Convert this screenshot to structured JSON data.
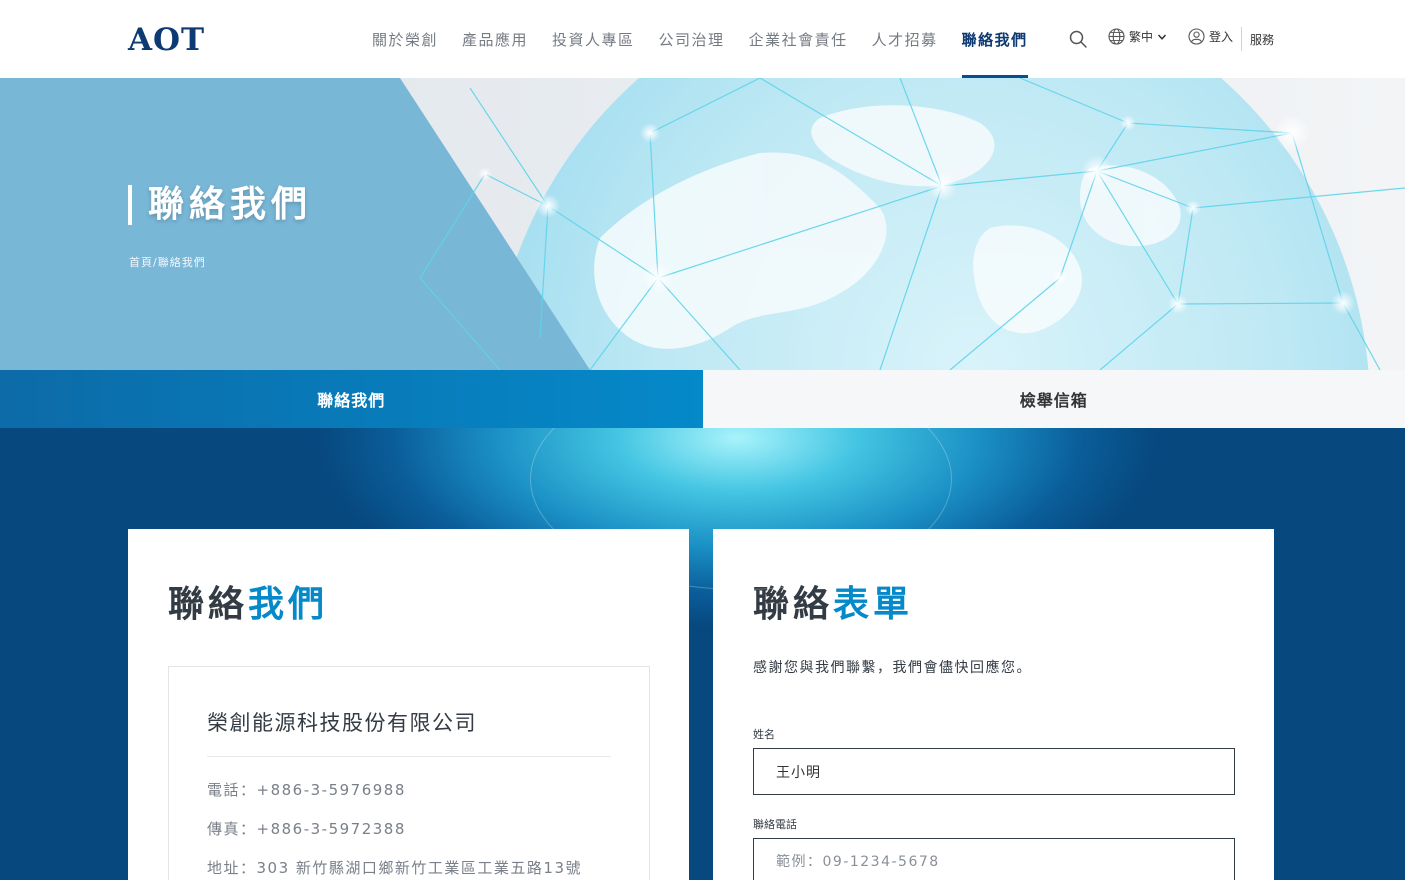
{
  "header": {
    "logo": "AOT",
    "nav": [
      "關於榮創",
      "產品應用",
      "投資人專區",
      "公司治理",
      "企業社會責任",
      "人才招募",
      "聯絡我們"
    ],
    "active_nav": "聯絡我們",
    "lang_label": "繁中",
    "login_label": "登入",
    "service_label": "服務"
  },
  "hero": {
    "title": "聯絡我們",
    "breadcrumb": "首頁/聯絡我們"
  },
  "tabs": [
    {
      "label": "聯絡我們",
      "active": true
    },
    {
      "label": "檢舉信箱",
      "active": false
    }
  ],
  "contact": {
    "title_part1": "聯絡",
    "title_part2": "我們",
    "company": "榮創能源科技股份有限公司",
    "phone": "電話：+886-3-5976988",
    "fax": "傳真：+886-3-5972388",
    "address": "地址：303 新竹縣湖口鄉新竹工業區工業五路13號"
  },
  "form": {
    "title_part1": "聯絡",
    "title_part2": "表單",
    "intro": "感謝您與我們聯繫，我們會儘快回應您。",
    "name_label": "姓名",
    "name_value": "王小明",
    "phone_label": "聯絡電話",
    "phone_placeholder": "範例：09-1234-5678"
  },
  "colors": {
    "brand_navy": "#0d3a72",
    "accent_blue": "#0589c9",
    "tab_active": "#0c6ba8"
  }
}
